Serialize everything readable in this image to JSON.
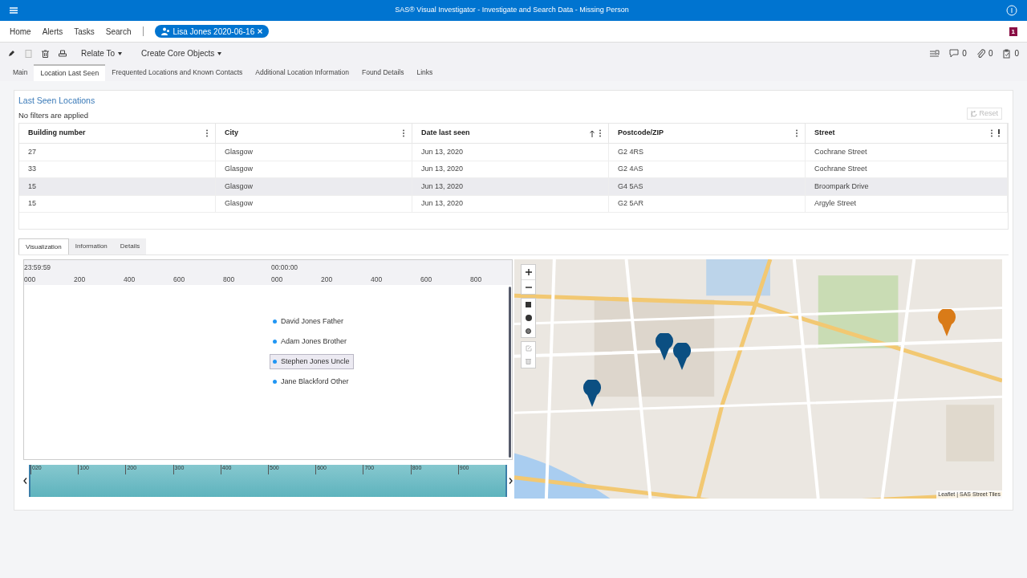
{
  "window": {
    "title": "SAS® Visual Investigator - Investigate and Search Data - Missing Person"
  },
  "nav": {
    "items": [
      "Home",
      "Alerts",
      "Tasks",
      "Search"
    ],
    "open_tab": "Lisa Jones 2020-06-16",
    "notification_count": "1"
  },
  "toolbar": {
    "menus": [
      "Relate To",
      "Create Core Objects"
    ],
    "counters": [
      {
        "kind": "comments",
        "count": "0"
      },
      {
        "kind": "attachments",
        "count": "0"
      },
      {
        "kind": "tasks",
        "count": "0"
      }
    ]
  },
  "tabs": [
    {
      "label": "Main",
      "selected": false
    },
    {
      "label": "Location Last Seen",
      "selected": true
    },
    {
      "label": "Frequented Locations and Known Contacts",
      "selected": false
    },
    {
      "label": "Additional Location Information",
      "selected": false
    },
    {
      "label": "Found Details",
      "selected": false
    },
    {
      "label": "Links",
      "selected": false
    }
  ],
  "section": {
    "title": "Last Seen Locations",
    "filter_status": "No filters are applied",
    "reset_label": "Reset"
  },
  "table": {
    "columns": [
      {
        "label": "Building number",
        "sorted": false
      },
      {
        "label": "City",
        "sorted": false
      },
      {
        "label": "Date last seen",
        "sorted": true
      },
      {
        "label": "Postcode/ZIP",
        "sorted": false
      },
      {
        "label": "Street",
        "sorted": false
      }
    ],
    "rows": [
      {
        "cells": [
          "27",
          "Glasgow",
          "Jun 13, 2020",
          "G2 4RS",
          "Cochrane Street"
        ],
        "selected": false
      },
      {
        "cells": [
          "33",
          "Glasgow",
          "Jun 13, 2020",
          "G2 4AS",
          "Cochrane Street"
        ],
        "selected": false
      },
      {
        "cells": [
          "15",
          "Glasgow",
          "Jun 13, 2020",
          "G4 5AS",
          "Broompark Drive"
        ],
        "selected": true
      },
      {
        "cells": [
          "15",
          "Glasgow",
          "Jun 13, 2020",
          "G2 5AR",
          "Argyle Street"
        ],
        "selected": false
      }
    ]
  },
  "detail_tabs": [
    {
      "label": "Visualization",
      "selected": true
    },
    {
      "label": "Information",
      "selected": false
    },
    {
      "label": "Details",
      "selected": false
    }
  ],
  "timeline": {
    "start_time": "23:59:59",
    "mid_time": "00:00:00",
    "ticks": [
      "000",
      "200",
      "400",
      "600",
      "800",
      "000",
      "200",
      "400",
      "600",
      "800"
    ],
    "entries": [
      {
        "label": "David Jones Father",
        "selected": false
      },
      {
        "label": "Adam Jones Brother",
        "selected": false
      },
      {
        "label": "Stephen Jones Uncle",
        "selected": true
      },
      {
        "label": "Jane Blackford Other",
        "selected": false
      }
    ],
    "overview_ticks": [
      "020",
      "100",
      "200",
      "300",
      "400",
      "500",
      "600",
      "700",
      "800",
      "900"
    ]
  },
  "map": {
    "markers": [
      {
        "color": "#0b4f82"
      },
      {
        "color": "#0b4f82"
      },
      {
        "color": "#0b4f82"
      },
      {
        "color": "#d97b18"
      }
    ],
    "attribution": "Leaflet | SAS Street Tiles"
  }
}
